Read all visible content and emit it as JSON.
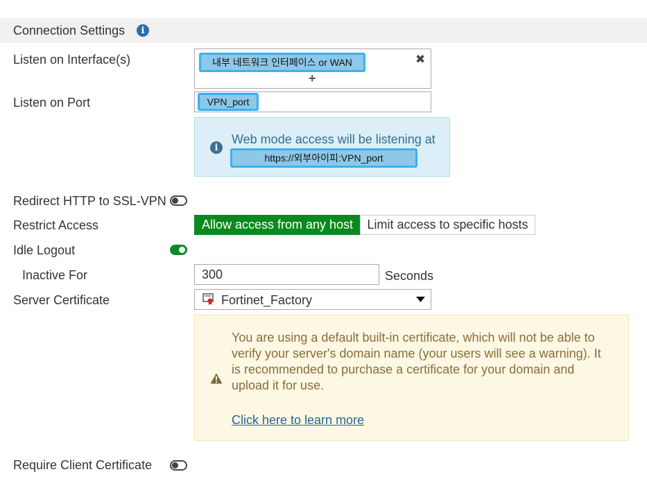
{
  "section": {
    "title": "Connection Settings"
  },
  "fields": {
    "listen_interface_label": "Listen on Interface(s)",
    "listen_interface_chip": "내부 네트워크 인터페이스 or WAN",
    "add_symbol": "+",
    "remove_symbol": "✖",
    "listen_port_label": "Listen on Port",
    "listen_port_chip": "VPN_port",
    "web_mode_text": "Web mode access will be listening at",
    "web_mode_url": "https://외부아이피:VPN_port",
    "redirect_label": "Redirect HTTP to SSL-VPN",
    "restrict_label": "Restrict Access",
    "restrict_option_active": "Allow access from any host",
    "restrict_option_inactive": "Limit access to specific hosts",
    "idle_logout_label": "Idle Logout",
    "inactive_for_label": "Inactive For",
    "inactive_for_value": "300",
    "inactive_for_unit": "Seconds",
    "server_cert_label": "Server Certificate",
    "server_cert_value": "Fortinet_Factory",
    "cert_warning_text": "You are using a default built-in certificate, which will not be able to verify your server's domain name (your users will see a warning). It is recommended to purchase a certificate for your domain and upload it for use.",
    "cert_learn_more": "Click here to learn more",
    "require_client_cert_label": "Require Client Certificate"
  },
  "toggles": {
    "redirect_http": "off",
    "idle_logout": "on",
    "require_client_cert": "off"
  },
  "icons": {
    "info": "info-icon",
    "remove": "close-icon",
    "add": "plus-icon",
    "certificate": "certificate-icon",
    "dropdown": "caret-down-icon",
    "warning": "warning-icon"
  },
  "colors": {
    "accent_green": "#0a8a1e",
    "chip_border": "#3ab1ec",
    "info_icon": "#2e6fa7",
    "link": "#2a6496"
  }
}
